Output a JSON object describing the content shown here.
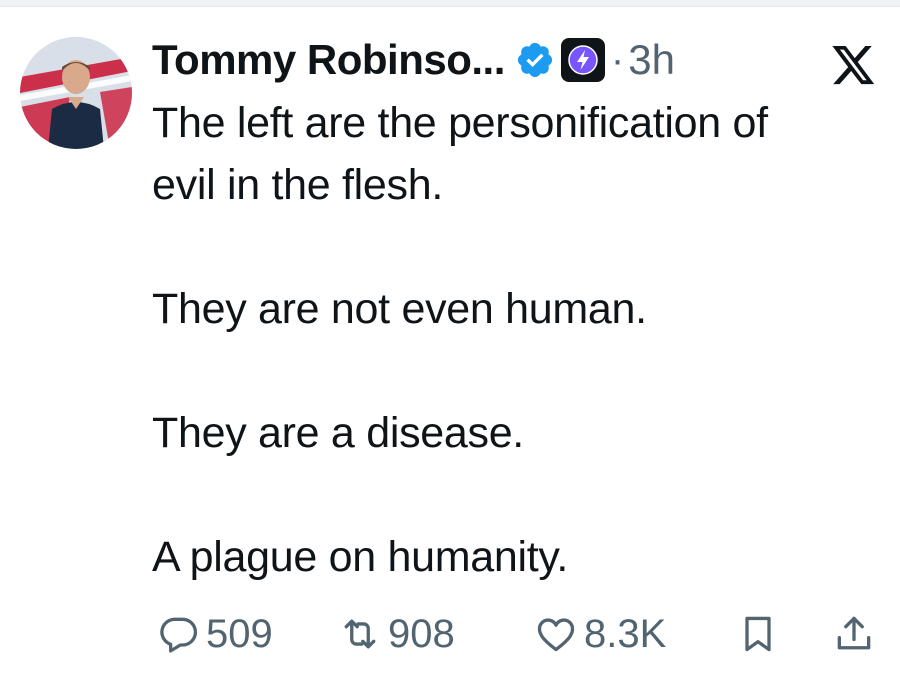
{
  "post": {
    "author": {
      "display_name": "Tommy Robinso...",
      "verified": true,
      "affiliate_badge_icon": "lightning-badge-icon",
      "avatar_icon": "avatar-photo"
    },
    "separator": "·",
    "timestamp": "3h",
    "platform_icon": "x-logo-icon",
    "lines": [
      "The left are the personification of",
      "evil in the flesh.",
      "",
      "They are not even human.",
      "",
      "They are a disease.",
      "",
      "A plague on humanity."
    ],
    "stats": {
      "replies": "509",
      "reposts": "908",
      "likes": "8.3K"
    }
  },
  "colors": {
    "text_primary": "#0f1419",
    "text_secondary": "#536471",
    "verified_blue": "#1d9bf0",
    "affiliate_purple": "#7856ff"
  }
}
